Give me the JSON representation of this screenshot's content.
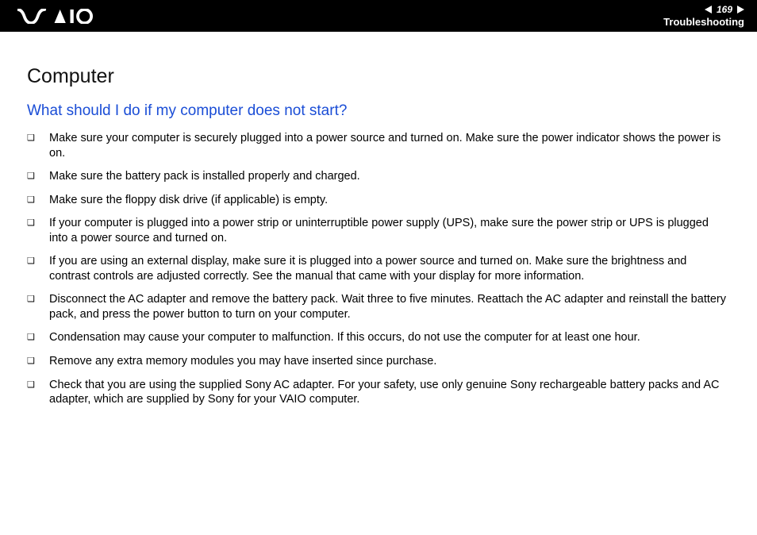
{
  "header": {
    "page_number": "169",
    "section": "Troubleshooting"
  },
  "content": {
    "section_heading": "Computer",
    "question": "What should I do if my computer does not start?",
    "bullets": [
      "Make sure your computer is securely plugged into a power source and turned on. Make sure the power indicator shows the power is on.",
      "Make sure the battery pack is installed properly and charged.",
      "Make sure the floppy disk drive (if applicable) is empty.",
      "If your computer is plugged into a power strip or uninterruptible power supply (UPS), make sure the power strip or UPS is plugged into a power source and turned on.",
      "If you are using an external display, make sure it is plugged into a power source and turned on. Make sure the brightness and contrast controls are adjusted correctly. See the manual that came with your display for more information.",
      "Disconnect the AC adapter and remove the battery pack. Wait three to five minutes. Reattach the AC adapter and reinstall the battery pack, and press the power button to turn on your computer.",
      "Condensation may cause your computer to malfunction. If this occurs, do not use the computer for at least one hour.",
      "Remove any extra memory modules you may have inserted since purchase.",
      "Check that you are using the supplied Sony AC adapter. For your safety, use only genuine Sony rechargeable battery packs and AC adapter, which are supplied by Sony for your VAIO computer."
    ]
  }
}
